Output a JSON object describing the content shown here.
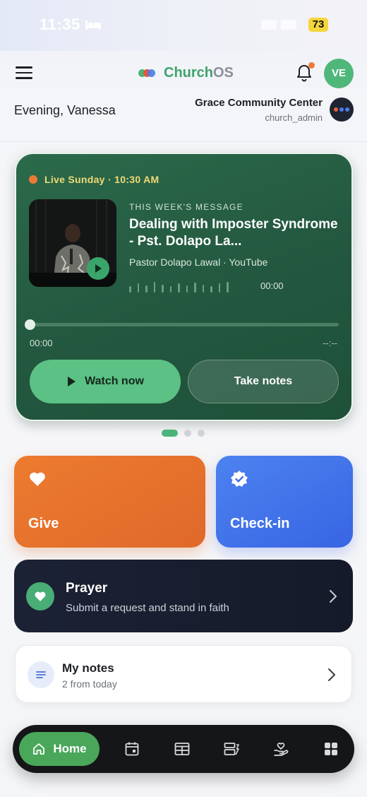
{
  "status_bar": {
    "time": "11:35",
    "battery": "73"
  },
  "header": {
    "app_name_part1": "Church",
    "app_name_part2": "OS",
    "avatar_initials": "VE",
    "greeting": "Evening, Vanessa",
    "org_name": "Grace Community Center",
    "org_role": "church_admin"
  },
  "hero": {
    "live_label": "Live Sunday · 10:30 AM",
    "eyebrow": "THIS WEEK'S MESSAGE",
    "title": "Dealing with Imposter Syndrome - Pst. Dolapo La...",
    "meta": "Pastor Dolapo Lawal · YouTube",
    "duration": "00:00",
    "elapsed": "00:00",
    "remaining": "--:--",
    "progress": 0,
    "watch_label": "Watch now",
    "notes_label": "Take notes"
  },
  "carousel": {
    "count": 3,
    "active": 0
  },
  "tiles": {
    "give_label": "Give",
    "checkin_label": "Check-in"
  },
  "prayer": {
    "title": "Prayer",
    "subtitle": "Submit a request and stand in faith"
  },
  "my_notes": {
    "title": "My notes",
    "subtitle": "2 from today"
  },
  "tabbar": {
    "home_label": "Home",
    "icons": [
      "calendar-icon",
      "events-icon",
      "media-icon",
      "giving-hand-icon",
      "more-grid-icon"
    ]
  },
  "colors": {
    "brand_green": "#3fa36b",
    "hero_bg": "#23573f",
    "give_orange": "#e56e2c",
    "checkin_blue": "#3f6de8",
    "prayer_dark": "#1a2032",
    "live_yellow": "#f1da76"
  }
}
